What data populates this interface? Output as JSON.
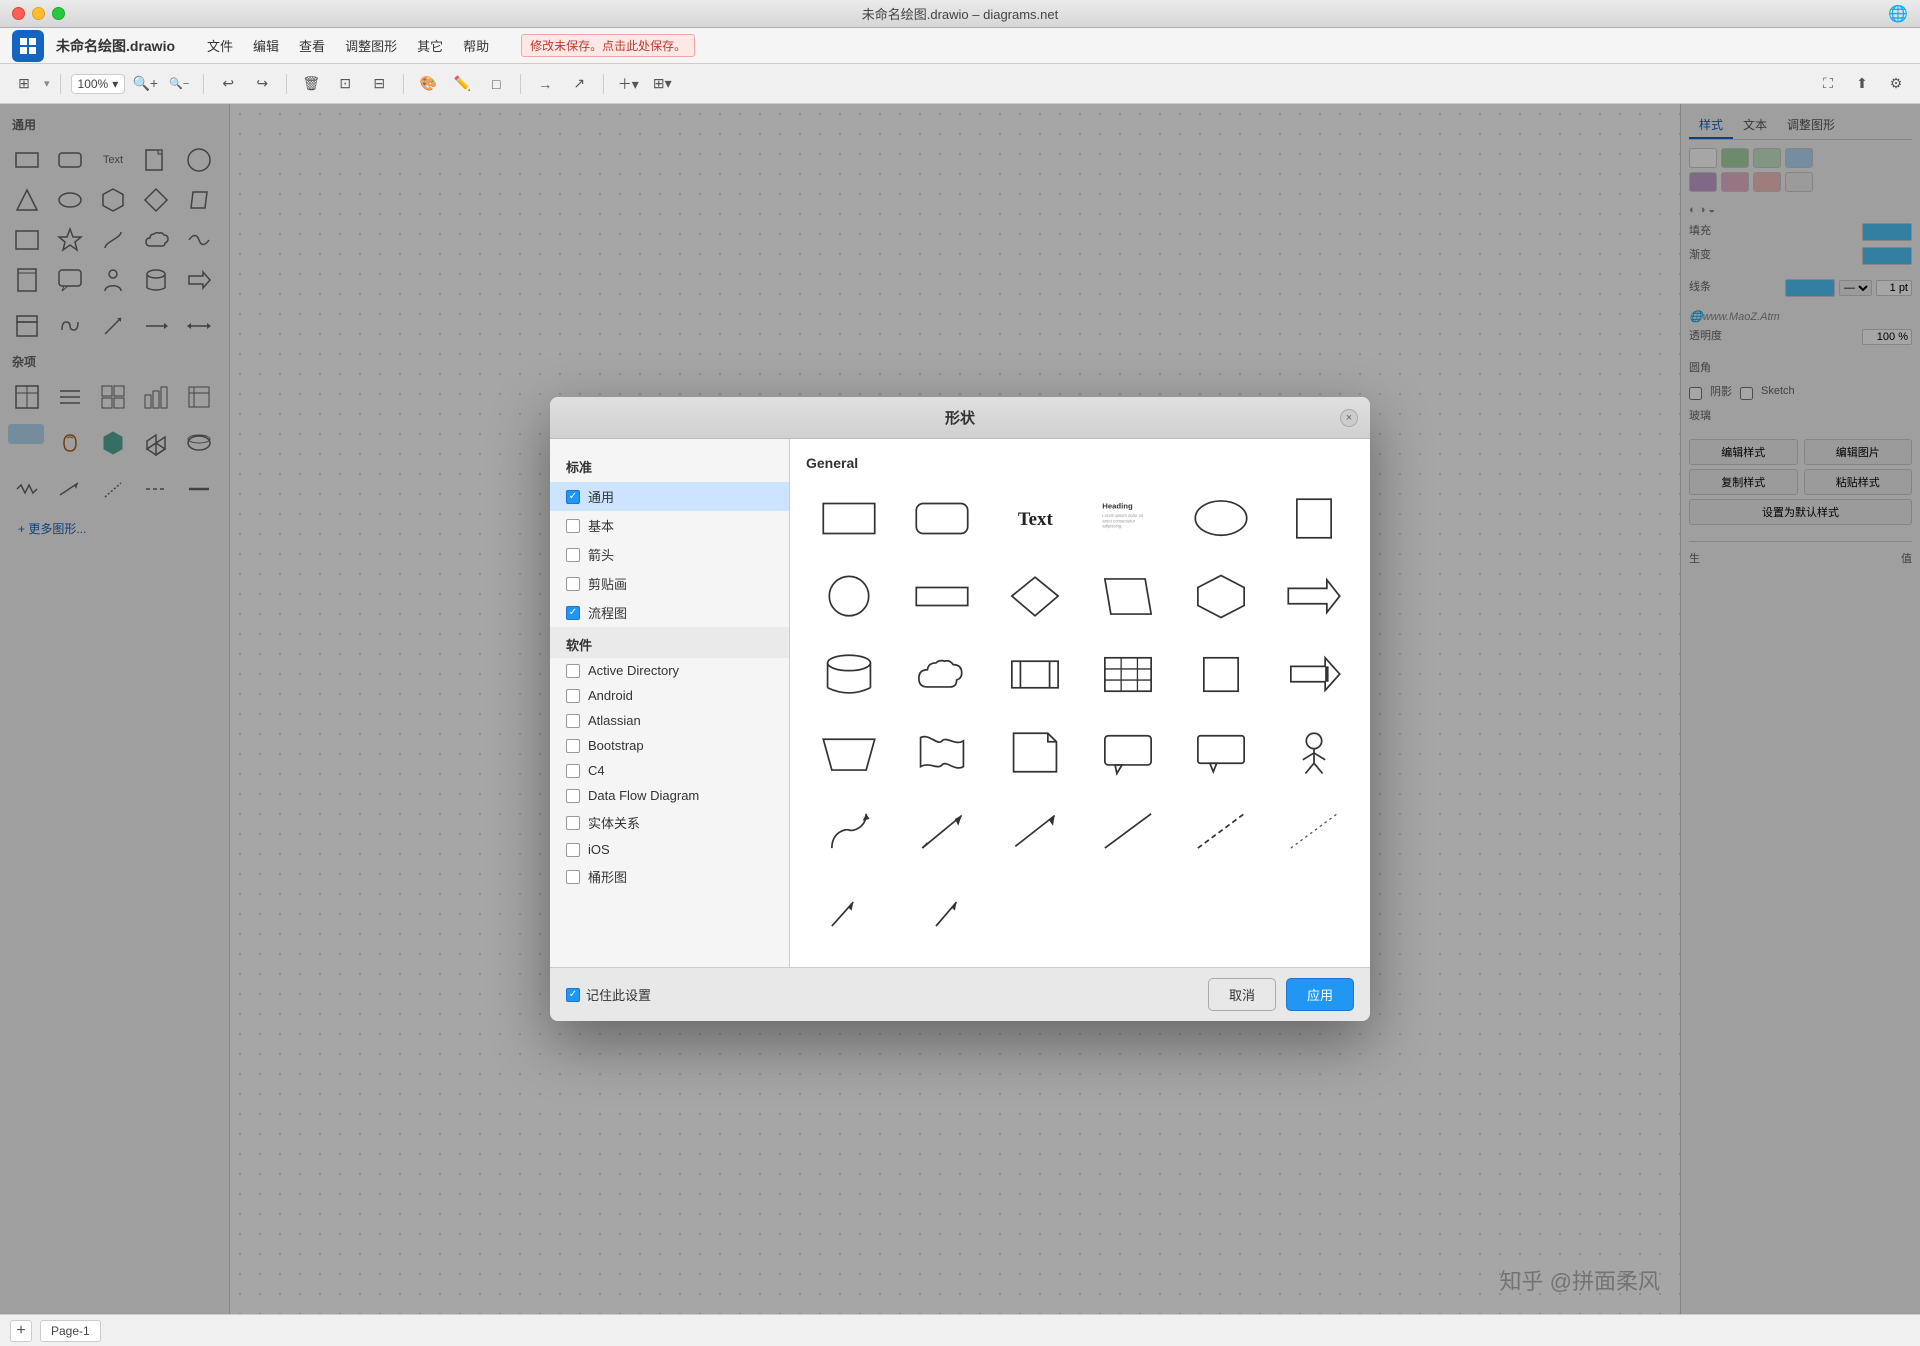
{
  "window": {
    "title": "未命名绘图.drawio – diagrams.net",
    "close_label": "×"
  },
  "menu": {
    "app_name": "未命名绘图.drawio",
    "items": [
      "文件",
      "编辑",
      "查看",
      "调整图形",
      "其它",
      "帮助"
    ],
    "save_notice": "修改未保存。点击此处保存。"
  },
  "toolbar": {
    "zoom_level": "100%"
  },
  "left_sidebar": {
    "section_general": "通用",
    "section_misc": "杂项",
    "more_shapes": "+ 更多图形..."
  },
  "modal": {
    "title": "形状",
    "standard_title": "标准",
    "categories": [
      {
        "label": "通用",
        "checked": true,
        "selected": true
      },
      {
        "label": "基本",
        "checked": false
      },
      {
        "label": "箭头",
        "checked": false
      },
      {
        "label": "剪贴画",
        "checked": false
      },
      {
        "label": "流程图",
        "checked": true
      }
    ],
    "software_title": "软件",
    "software_items": [
      {
        "label": "Active Directory",
        "checked": false
      },
      {
        "label": "Android",
        "checked": false
      },
      {
        "label": "Atlassian",
        "checked": false
      },
      {
        "label": "Bootstrap",
        "checked": false
      },
      {
        "label": "C4",
        "checked": false
      },
      {
        "label": "Data Flow Diagram",
        "checked": false
      },
      {
        "label": "实体关系",
        "checked": false
      },
      {
        "label": "iOS",
        "checked": false
      },
      {
        "label": "桶形图",
        "checked": false
      }
    ],
    "preview_section": "General",
    "remember_label": "记住此设置",
    "cancel_label": "取消",
    "apply_label": "应用"
  },
  "right_panel": {
    "tab_style": "样式",
    "tab_text": "文本",
    "tab_adjust": "调整图形",
    "fill_label": "填充",
    "gradient_label": "渐变",
    "line_label": "线条",
    "opacity_label": "透明度",
    "opacity_value": "100 %",
    "corner_label": "圆角",
    "shadow_label": "阴影",
    "glass_label": "玻璃",
    "sketch_label": "Sketch",
    "line_width": "1 pt",
    "btns": {
      "edit_style": "编辑样式",
      "edit_image": "编辑图片",
      "copy_style": "复制样式",
      "paste_style": "粘贴样式",
      "set_default": "设置为默认样式"
    }
  },
  "bottom_bar": {
    "page_label": "Page-1",
    "add_page": "+"
  },
  "colors": {
    "swatch1": "#ffffff",
    "swatch2": "#a8d4a8",
    "swatch3": "#c8e6c9",
    "swatch4": "#b3d9f7",
    "swatch5": "#c5a0d0",
    "swatch6": "#e8b4c8",
    "swatch7": "#f5c0c0",
    "fill_blue": "#4fc3f7",
    "line_blue": "#4fc3f7"
  }
}
